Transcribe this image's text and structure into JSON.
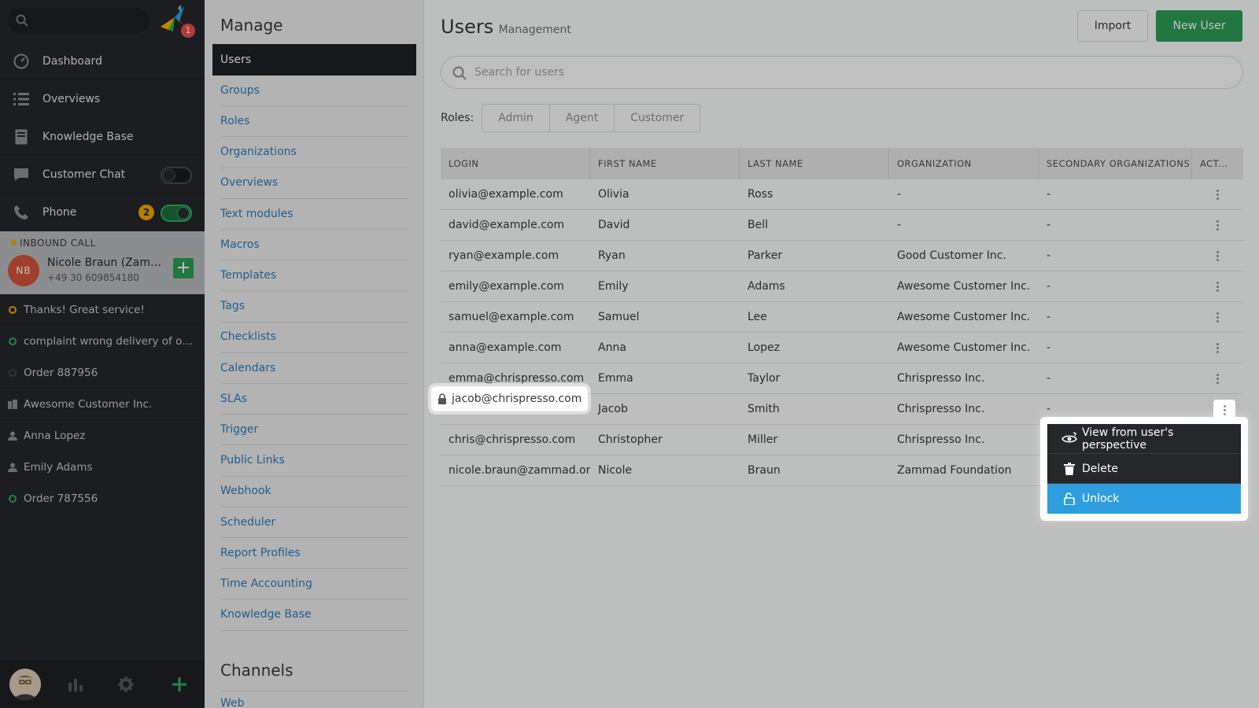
{
  "nav": {
    "search_placeholder": "",
    "logo_badge": "1",
    "items": [
      {
        "label": "Dashboard",
        "icon": "dashboard-icon"
      },
      {
        "label": "Overviews",
        "icon": "list-icon"
      },
      {
        "label": "Knowledge Base",
        "icon": "book-icon"
      },
      {
        "label": "Customer Chat",
        "icon": "chat-icon",
        "toggle": false
      },
      {
        "label": "Phone",
        "icon": "phone-icon",
        "toggle": true,
        "badge": "2"
      }
    ],
    "call": {
      "label": "INBOUND CALL",
      "initials": "NB",
      "name": "Nicole Braun (Zammad Foundation)",
      "number": "+49 30 609854180"
    },
    "tasks": [
      {
        "label": "Thanks! Great service!",
        "icon": "ticket-open-icon",
        "color": "#f0a800"
      },
      {
        "label": "complaint wrong delivery of order",
        "icon": "ticket-open-icon",
        "color": "#2fae62"
      },
      {
        "label": "Order 887956",
        "icon": "ticket-closed-icon",
        "color": "#55575a"
      },
      {
        "label": "Awesome Customer Inc.",
        "icon": "organization-icon",
        "color": "#8e9093"
      },
      {
        "label": "Anna Lopez",
        "icon": "user-icon",
        "color": "#8e9093"
      },
      {
        "label": "Emily Adams",
        "icon": "user-icon",
        "color": "#8e9093"
      },
      {
        "label": "Order 787556",
        "icon": "ticket-open-icon",
        "color": "#2fae62"
      }
    ]
  },
  "manage": {
    "heading": "Manage",
    "items": [
      "Users",
      "Groups",
      "Roles",
      "Organizations",
      "Overviews",
      "Text modules",
      "Macros",
      "Templates",
      "Tags",
      "Checklists",
      "Calendars",
      "SLAs",
      "Trigger",
      "Public Links",
      "Webhook",
      "Scheduler",
      "Report Profiles",
      "Time Accounting",
      "Knowledge Base"
    ],
    "active": "Users",
    "channels_heading": "Channels",
    "channels_first": "Web"
  },
  "main": {
    "title": "Users",
    "subtitle": "Management",
    "import_label": "Import",
    "new_user_label": "New User",
    "search_placeholder": "Search for users",
    "roles_label": "Roles:",
    "roles": [
      "Admin",
      "Agent",
      "Customer"
    ],
    "columns": [
      "LOGIN",
      "FIRST NAME",
      "LAST NAME",
      "ORGANIZATION",
      "SECONDARY ORGANIZATIONS",
      "ACT..."
    ],
    "rows": [
      {
        "login": "olivia@example.com",
        "first": "Olivia",
        "last": "Ross",
        "org": "-",
        "sec": "-"
      },
      {
        "login": "david@example.com",
        "first": "David",
        "last": "Bell",
        "org": "-",
        "sec": "-"
      },
      {
        "login": "ryan@example.com",
        "first": "Ryan",
        "last": "Parker",
        "org": "Good Customer Inc.",
        "sec": "-"
      },
      {
        "login": "emily@example.com",
        "first": "Emily",
        "last": "Adams",
        "org": "Awesome Customer Inc.",
        "sec": "-"
      },
      {
        "login": "samuel@example.com",
        "first": "Samuel",
        "last": "Lee",
        "org": "Awesome Customer Inc.",
        "sec": "-"
      },
      {
        "login": "anna@example.com",
        "first": "Anna",
        "last": "Lopez",
        "org": "Awesome Customer Inc.",
        "sec": "-"
      },
      {
        "login": "emma@chrispresso.com",
        "first": "Emma",
        "last": "Taylor",
        "org": "Chrispresso Inc.",
        "sec": "-"
      },
      {
        "login": "jacob@chrispresso.com",
        "first": "Jacob",
        "last": "Smith",
        "org": "Chrispresso Inc.",
        "sec": "-",
        "locked": true
      },
      {
        "login": "chris@chrispresso.com",
        "first": "Christopher",
        "last": "Miller",
        "org": "Chrispresso Inc.",
        "sec": ""
      },
      {
        "login": "nicole.braun@zammad.org",
        "first": "Nicole",
        "last": "Braun",
        "org": "Zammad Foundation",
        "sec": ""
      }
    ]
  },
  "action_menu": {
    "items": [
      {
        "label": "View from user's perspective",
        "icon": "eye-switch-icon"
      },
      {
        "label": "Delete",
        "icon": "trash-icon"
      },
      {
        "label": "Unlock",
        "icon": "unlock-icon",
        "highlighted": true
      }
    ]
  }
}
